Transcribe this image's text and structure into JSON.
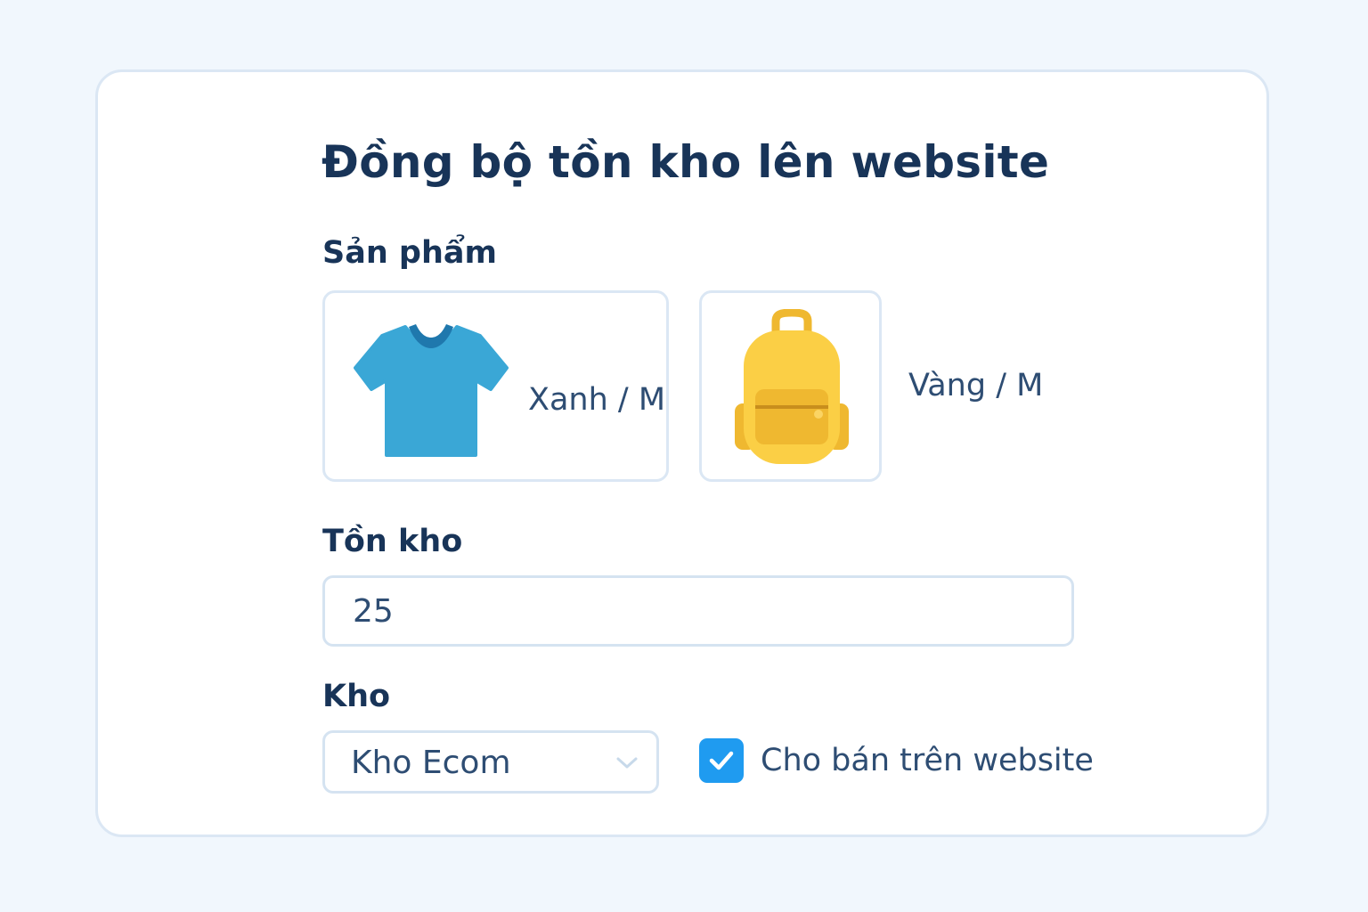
{
  "form": {
    "title": "Đồng bộ tồn kho lên website",
    "products_label": "Sản phẩm",
    "products": [
      {
        "variant": "Xanh / M",
        "icon": "t-shirt-icon",
        "color": "#3aa7d6"
      },
      {
        "variant": "Vàng / M",
        "icon": "backpack-icon",
        "color": "#fbcf45"
      }
    ],
    "stock_label": "Tồn kho",
    "stock_value": "25",
    "warehouse_label": "Kho",
    "warehouse_value": "Kho Ecom",
    "sell_on_website_label": "Cho bán trên website",
    "sell_on_website_checked": true
  },
  "colors": {
    "accent": "#1f9bf0",
    "heading": "#183458",
    "text": "#2e4d73",
    "border": "#d5e3f1",
    "background": "#f1f7fd"
  }
}
